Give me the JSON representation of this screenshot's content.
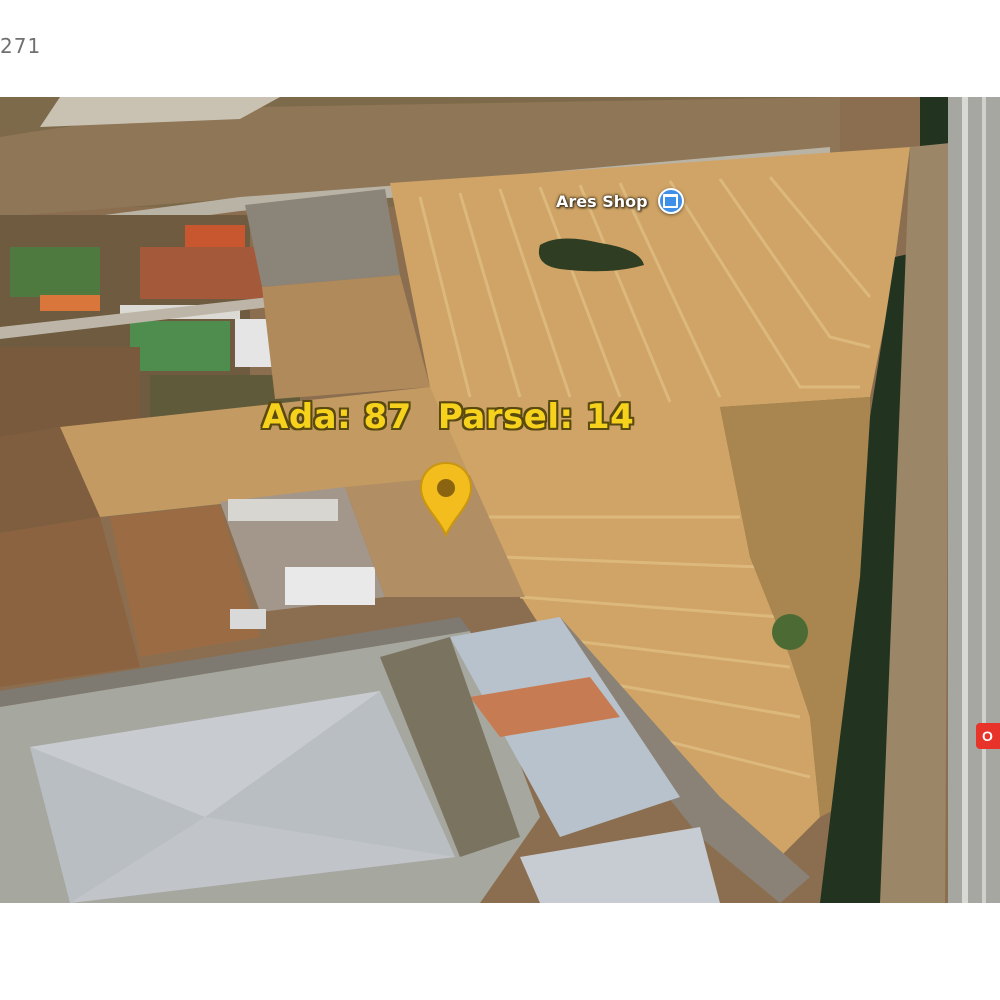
{
  "header": {
    "counter_text": "271"
  },
  "map": {
    "type": "satellite",
    "parcel_label": {
      "ada": "Ada: 87",
      "parsel": "Parsel: 14",
      "color": "#f7d21c"
    },
    "place": {
      "name": "Ares Shop",
      "icon": "shopping-bag-icon",
      "icon_color": "#3d8fe8"
    },
    "pin": {
      "icon": "location-pin-icon",
      "color": "#f2bd1d"
    },
    "edge_badge": {
      "text": "O",
      "color": "#e8332a"
    }
  }
}
